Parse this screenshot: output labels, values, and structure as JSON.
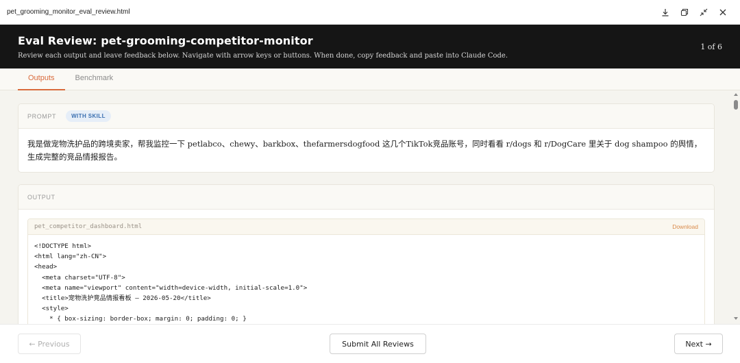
{
  "window": {
    "filename": "pet_grooming_monitor_eval_review.html"
  },
  "icons": [
    "download-icon",
    "restore-icon",
    "collapse-icon",
    "close-icon"
  ],
  "header": {
    "title": "Eval Review: pet-grooming-competitor-monitor",
    "subtitle": "Review each output and leave feedback below. Navigate with arrow keys or buttons. When done, copy feedback and paste into Claude Code.",
    "counter": "1 of 6"
  },
  "tabs": [
    {
      "label": "Outputs",
      "active": true
    },
    {
      "label": "Benchmark",
      "active": false
    }
  ],
  "prompt": {
    "label": "PROMPT",
    "badge": "WITH SKILL",
    "text": "我是做宠物洗护品的跨境卖家，帮我监控一下 petlabco、chewy、barkbox、thefarmersdogfood 这几个TikTok竞品账号，同时看看 r/dogs 和 r/DogCare 里关于 dog shampoo 的舆情，生成完整的竞品情报报告。"
  },
  "output": {
    "label": "OUTPUT",
    "file_name": "pet_competitor_dashboard.html",
    "download_label": "Download",
    "code_lines": [
      "<!DOCTYPE html>",
      "<html lang=\"zh-CN\">",
      "<head>",
      "  <meta charset=\"UTF-8\">",
      "  <meta name=\"viewport\" content=\"width=device-width, initial-scale=1.0\">",
      "  <title>宠物洗护竞品情报看板 — 2026-05-20</title>",
      "  <style>",
      "    * { box-sizing: border-box; margin: 0; padding: 0; }"
    ]
  },
  "footer": {
    "previous_label": "← Previous",
    "submit_label": "Submit All Reviews",
    "next_label": "Next →"
  },
  "colors": {
    "accent": "#d96a3b",
    "header_bg": "#151515",
    "badge_text": "#3a6fb0",
    "badge_bg": "#e6eef8"
  }
}
